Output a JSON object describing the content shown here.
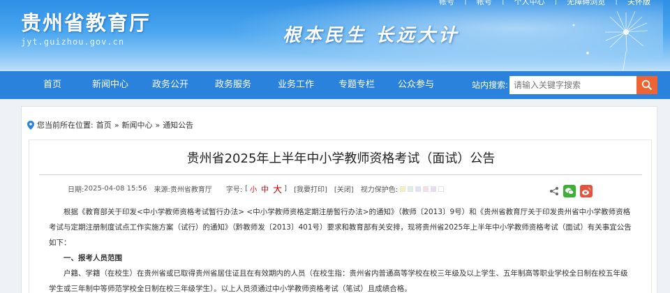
{
  "header": {
    "site_name": "贵州省教育厅",
    "domain": "jyt.guizhou.gov.cn",
    "slogan": "根本民生 长远大计",
    "top_links": [
      "帐号",
      "帐号",
      "个人中心",
      "无障碍浏览",
      "关怀版"
    ]
  },
  "nav": {
    "items": [
      "首页",
      "新闻中心",
      "政务公开",
      "政务服务",
      "业务工作",
      "专题专栏",
      "公众参与"
    ],
    "search_label": "站内搜索:",
    "search_placeholder": "请输入关键字搜索"
  },
  "breadcrumb": {
    "prefix": "您当前所在位置:",
    "items": [
      "首页",
      "新闻中心",
      "通知公告"
    ],
    "separator": "»"
  },
  "article": {
    "title": "贵州省2025年上半年中小学教师资格考试（面试）公告",
    "meta": {
      "date_label": "日期:",
      "date": "2025-04-08 15:56",
      "source_label": "来源:",
      "source": "贵州省教育厅",
      "font_label": "字号:",
      "bracket_open": "[",
      "bracket_close": "]",
      "font_small": "小",
      "font_medium": "中",
      "font_large": "大",
      "print": "[我要打印]",
      "close": "[关闭]",
      "eye_label": "视力保护色:",
      "swatches": [
        "#f7f0b7",
        "#d8f0e4",
        "#dde3f5",
        "#f4dde8",
        "#e5dcf2",
        "#ffffff"
      ]
    },
    "share_icons": [
      "share-icon",
      "wechat-icon",
      "weibo-icon"
    ],
    "paragraphs": [
      "根据《教育部关于印发<中小学教师资格考试暂行办法> <中小学教师资格定期注册暂行办法>的通知》（教师〔2013〕9号）和《贵州省教育厅关于印发贵州省中小学教师资格考试与定期注册制度试点工作实施方案（试行）的通知》（黔教师发〔2013〕401号）要求和教育部有关安排，现将贵州省2025年上半年中小学教师资格考试（面试）有关事宜公告如下：",
      "一、报考人员范围",
      "户籍、学籍（在校生）在贵州省或已取得贵州省居住证且在有效期内的人员（在校生指：贵州省内普通高等学校在校三年级及以上学生、五年制高等职业学校全日制在校五年级学生或三年制中等师范学校全日制在校三年级学生）。以上人员须通过中小学教师资格考试（笔试）且成绩合格。"
    ]
  },
  "colors": {
    "nav_bg": "#2a82dd",
    "search_button": "#ee6433",
    "font_size_accent": "#cc0000"
  }
}
